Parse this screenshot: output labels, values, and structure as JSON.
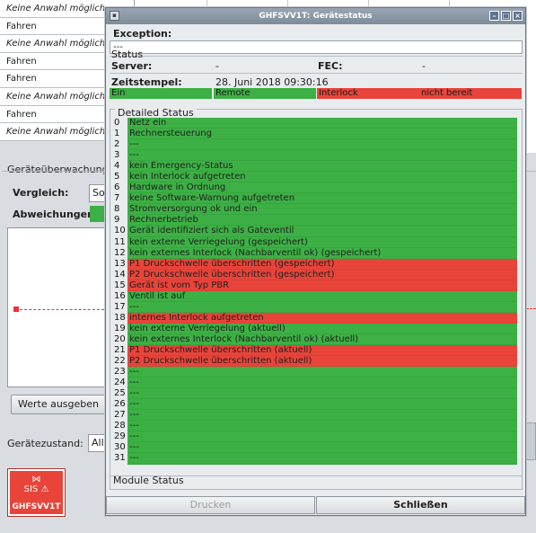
{
  "background": {
    "list_rows": [
      {
        "text": "Keine Anwahl möglich",
        "italic": true
      },
      {
        "text": "Fahren",
        "italic": false
      },
      {
        "text": "Keine Anwahl möglich",
        "italic": true
      },
      {
        "text": "Fahren",
        "italic": false
      },
      {
        "text": "Fahren",
        "italic": false
      },
      {
        "text": "Keine Anwahl möglich",
        "italic": true
      },
      {
        "text": "Fahren",
        "italic": false
      },
      {
        "text": "Keine Anwahl möglich",
        "italic": true
      }
    ],
    "section_title": "Geräteüberwachung",
    "vergleich_label": "Vergleich:",
    "vergleich_value": "So",
    "abweichungen_label": "Abweichungen:",
    "werte_button": "Werte ausgeben",
    "geraetezustand_label": "Gerätezustand:",
    "geraetezustand_value": "All",
    "tile_name": "GHFSVV1T",
    "tile_icon_top": "⋈",
    "tile_icon_bottom": "SIS"
  },
  "dialog": {
    "title": "GHFSVV1T: Gerätestatus",
    "exception_label": "Exception:",
    "exception_value": "---",
    "status_group": "Status",
    "server_label": "Server:",
    "server_value": "-",
    "fec_label": "FEC:",
    "fec_value": "-",
    "timestamp_label": "Zeitstempel:",
    "timestamp_value": "28. Juni 2018 09:30:16",
    "status_cells": [
      {
        "text": "Ein",
        "color": "#3cb044"
      },
      {
        "text": "Remote",
        "color": "#3cb044"
      },
      {
        "text": "Interlock",
        "color": "#e8443a"
      },
      {
        "text": "nicht bereit",
        "color": "#e8443a"
      }
    ],
    "detailed_title": "Detailed Status",
    "detailed_rows": [
      {
        "idx": "0",
        "text": "Netz ein",
        "state": "green"
      },
      {
        "idx": "1",
        "text": "Rechnersteuerung",
        "state": "green"
      },
      {
        "idx": "2",
        "text": "---",
        "state": "green"
      },
      {
        "idx": "3",
        "text": "---",
        "state": "green"
      },
      {
        "idx": "4",
        "text": "kein Emergency-Status",
        "state": "green"
      },
      {
        "idx": "5",
        "text": "kein Interlock aufgetreten",
        "state": "green"
      },
      {
        "idx": "6",
        "text": "Hardware in Ordnung",
        "state": "green"
      },
      {
        "idx": "7",
        "text": "keine Software-Warnung aufgetreten",
        "state": "green"
      },
      {
        "idx": "8",
        "text": "Stromversorgung ok und ein",
        "state": "green"
      },
      {
        "idx": "9",
        "text": "Rechnerbetrieb",
        "state": "green"
      },
      {
        "idx": "10",
        "text": "Gerät identifiziert sich als Gateventil",
        "state": "green"
      },
      {
        "idx": "11",
        "text": "kein externe Verriegelung (gespeichert)",
        "state": "green"
      },
      {
        "idx": "12",
        "text": "kein externes Interlock (Nachbarventil ok) (gespeichert)",
        "state": "green"
      },
      {
        "idx": "13",
        "text": "P1 Druckschwelle überschritten (gespeichert)",
        "state": "red"
      },
      {
        "idx": "14",
        "text": "P2 Druckschwelle überschritten (gespeichert)",
        "state": "red"
      },
      {
        "idx": "15",
        "text": "Gerät ist vom Typ PBR",
        "state": "red"
      },
      {
        "idx": "16",
        "text": "Ventil ist auf",
        "state": "green"
      },
      {
        "idx": "17",
        "text": "---",
        "state": "green"
      },
      {
        "idx": "18",
        "text": "internes Interlock aufgetreten",
        "state": "red"
      },
      {
        "idx": "19",
        "text": "kein externe Verriegelung (aktuell)",
        "state": "green"
      },
      {
        "idx": "20",
        "text": "kein externes Interlock (Nachbarventil ok) (aktuell)",
        "state": "green"
      },
      {
        "idx": "21",
        "text": "P1 Druckschwelle überschritten (aktuell)",
        "state": "red"
      },
      {
        "idx": "22",
        "text": "P2 Druckschwelle überschritten (aktuell)",
        "state": "red"
      },
      {
        "idx": "23",
        "text": "---",
        "state": "green"
      },
      {
        "idx": "24",
        "text": "---",
        "state": "green"
      },
      {
        "idx": "25",
        "text": "---",
        "state": "green"
      },
      {
        "idx": "26",
        "text": "---",
        "state": "green"
      },
      {
        "idx": "27",
        "text": "---",
        "state": "green"
      },
      {
        "idx": "28",
        "text": "---",
        "state": "green"
      },
      {
        "idx": "29",
        "text": "---",
        "state": "green"
      },
      {
        "idx": "30",
        "text": "---",
        "state": "green"
      },
      {
        "idx": "31",
        "text": "---",
        "state": "green"
      }
    ],
    "module_status_title": "Module Status",
    "print_button": "Drucken",
    "close_button": "Schließen"
  },
  "colors": {
    "green": "#3cb044",
    "red": "#e8443a"
  }
}
